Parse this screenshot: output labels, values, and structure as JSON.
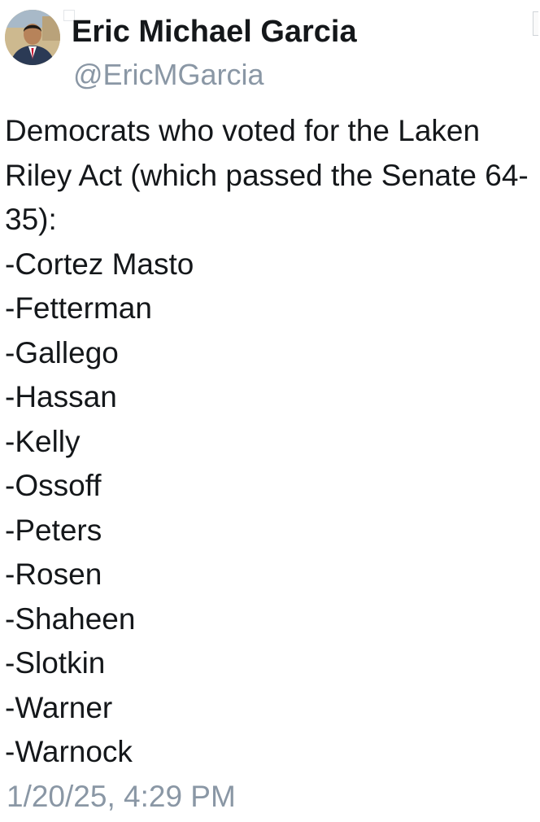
{
  "author": {
    "display_name": "Eric Michael Garcia",
    "handle": "@EricMGarcia",
    "avatar_icon": "profile-photo"
  },
  "tweet": {
    "intro": "Democrats who voted for the Laken Riley Act (which passed the Senate 64-35):",
    "voters": [
      "-Cortez Masto",
      "-Fetterman",
      "-Gallego",
      "-Hassan",
      "-Kelly",
      "-Ossoff",
      "-Peters",
      "-Rosen",
      "-Shaheen",
      "-Slotkin",
      "-Warner",
      "-Warnock"
    ],
    "timestamp": "1/20/25, 4:29 PM"
  },
  "colors": {
    "text": "#14171a",
    "muted": "#8a97a5",
    "background": "#ffffff"
  }
}
